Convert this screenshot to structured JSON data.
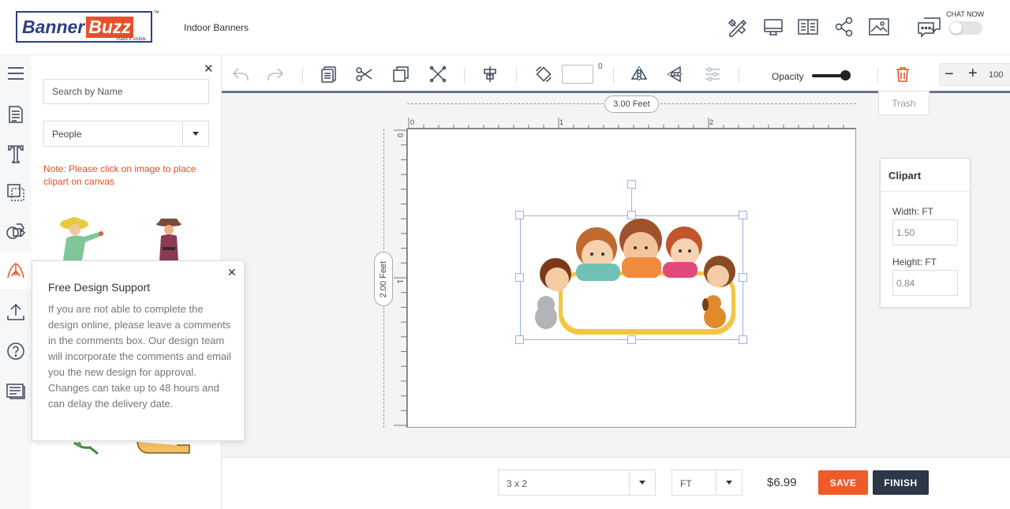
{
  "brand": {
    "name_part1": "Banner",
    "name_part2": "Buzz",
    "tagline": "make it visible",
    "trademark": "™"
  },
  "header": {
    "product": "Indoor Banners",
    "icons": [
      "design-tools-icon",
      "preview-monitor-icon",
      "guide-book-icon",
      "share-icon",
      "image-gallery-icon",
      "chat-icon"
    ],
    "chat_label": "CHAT NOW",
    "chat_enabled": false
  },
  "rail": {
    "items": [
      "menu-icon",
      "templates-icon",
      "text-icon",
      "background-icon",
      "shapes-icon",
      "clipart-icon",
      "upload-icon",
      "help-icon",
      "comments-icon"
    ],
    "active": "clipart-icon"
  },
  "panel": {
    "search_placeholder": "Search by Name",
    "category": "People",
    "note": "Note: Please click on image to place clipart on canvas"
  },
  "support": {
    "title": "Free Design Support",
    "body": "If you are not able to complete the design online, please leave a comments in the comments box. Our design team will incorporate the comments and email you the new design for approval. Changes can take up to 48 hours and can delay the delivery date."
  },
  "toolbar": {
    "rotation_unit": "0",
    "opacity_label": "Opacity",
    "opacity_value": 1.0,
    "zoom_minus": "−",
    "zoom_plus": "+",
    "zoom_value": "100",
    "trash_tooltip": "Trash"
  },
  "canvas": {
    "width_label": "3.00 Feet",
    "height_label": "2.00 Feet",
    "ruler_top": [
      "0",
      "1",
      "2"
    ],
    "ruler_left": [
      "0",
      "1"
    ]
  },
  "props": {
    "title": "Clipart",
    "width_label": "Width: FT",
    "width_value": "1.50",
    "height_label": "Height: FT",
    "height_value": "0.84"
  },
  "footer": {
    "size": "3 x 2",
    "unit": "FT",
    "price": "$6.99",
    "save": "SAVE",
    "finish": "FINISH"
  },
  "colors": {
    "accent": "#f05a28",
    "dark": "#2c3848",
    "brand_blue": "#2b3e87",
    "selection": "#9db0e6",
    "note": "#e44d26"
  }
}
